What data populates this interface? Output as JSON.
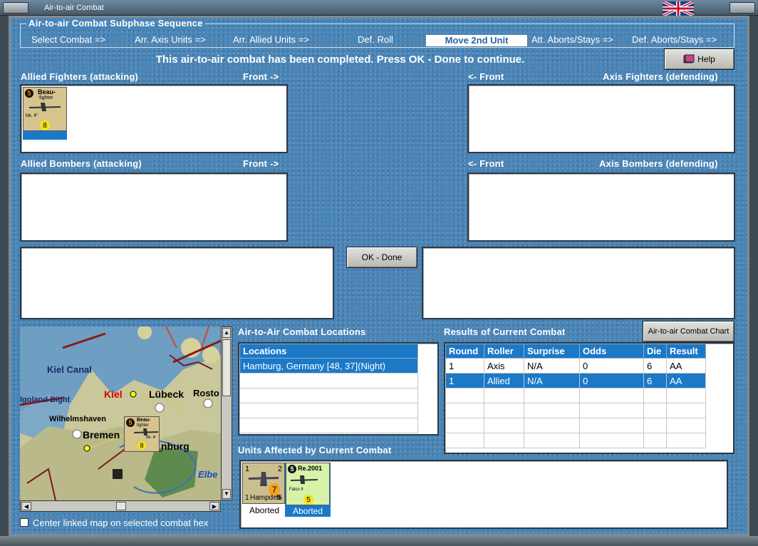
{
  "window": {
    "title": "Air-to-air Combat"
  },
  "sequence": {
    "title": "Air-to-air Combat Subphase Sequence",
    "steps": [
      {
        "label": "Select Combat =>"
      },
      {
        "label": "Arr. Axis Units =>"
      },
      {
        "label": "Arr. Allied Units =>"
      },
      {
        "label": "Def. Roll"
      },
      {
        "label": "Move 2nd Unit"
      },
      {
        "label": "Att. Aborts/Stays =>"
      },
      {
        "label": "Def. Aborts/Stays =>"
      }
    ],
    "active_index": 4
  },
  "status_message": "This air-to-air combat has been completed.  Press OK - Done to continue.",
  "help_button": "Help",
  "panels": {
    "allied_fighters": {
      "label": "Allied Fighters (attacking)",
      "front": "Front ->"
    },
    "axis_fighters": {
      "label": "Axis Fighters (defending)",
      "front": "<- Front"
    },
    "allied_bombers": {
      "label": "Allied Bombers (attacking)",
      "front": "Front ->"
    },
    "axis_bombers": {
      "label": "Axis Bombers (defending)",
      "front": "<- Front"
    }
  },
  "allied_fighter_unit": {
    "name_line1": "Beau-",
    "name_line2": "fighter",
    "model": "Mk. IF",
    "strength": "5",
    "factor": "8"
  },
  "ok_button": "OK - Done",
  "locations": {
    "title": "Air-to-Air Combat Locations",
    "column": "Locations",
    "rows": [
      "Hamburg, Germany [48, 37](Night)"
    ]
  },
  "results": {
    "title": "Results of Current Combat",
    "chart_button": "Air-to-air Combat Chart",
    "columns": [
      "Round",
      "Roller",
      "Surprise",
      "Odds",
      "Die",
      "Result"
    ],
    "rows": [
      [
        "1",
        "Axis",
        "N/A",
        "0",
        "6",
        "AA"
      ],
      [
        "1",
        "Allied",
        "N/A",
        "0",
        "6",
        "AA"
      ]
    ]
  },
  "affected": {
    "title": "Units Affected by Current Combat",
    "units": [
      {
        "name": "Hampden",
        "top_num": "1",
        "top_right": "2",
        "bottom_left": "1",
        "bottom_mid": "5",
        "bottom_right": "5",
        "factor": "7",
        "status": "Aborted"
      },
      {
        "name": "Re.2001",
        "model": "Falco II",
        "strength": "5",
        "factor": "5",
        "status": "Aborted"
      }
    ]
  },
  "map": {
    "labels": {
      "kiel_canal": "Kiel Canal",
      "kiel": "Kiel",
      "lubeck": "Lübeck",
      "rostock": "Rosto",
      "heligoland": "lgoland Bight",
      "wilhelmshaven": "Wilhelmshaven",
      "bremen": "Bremen",
      "hamburg": "nburg",
      "elbe": "Elbe"
    },
    "counter": {
      "name_line1": "Beau-",
      "name_line2": "fighter",
      "model": "Mk. IF",
      "strength": "5",
      "factor": "8"
    }
  },
  "center_checkbox": {
    "label": "Center linked map on selected combat hex",
    "checked": false
  },
  "colors": {
    "selection": "#1b79c8",
    "panel_bg": "#4a85b7"
  }
}
